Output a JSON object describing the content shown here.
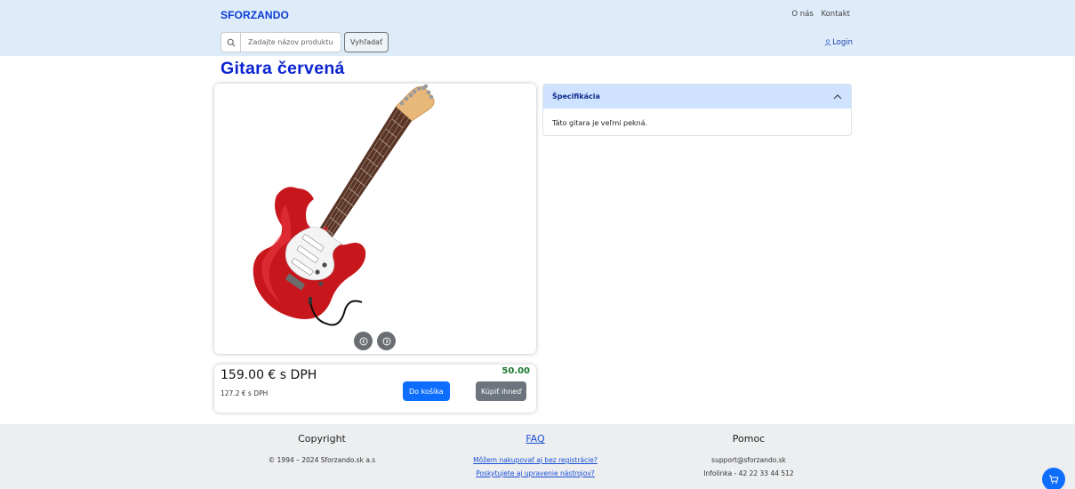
{
  "header": {
    "brand": "SFORZANDO",
    "nav": [
      "O nás",
      "Kontakt"
    ],
    "search_placeholder": "Zadajte názov produktu",
    "search_button": "Vyhľadať",
    "login": "Login"
  },
  "product": {
    "title": "Gitara červená",
    "image_alt": "red electric guitar",
    "price_with_vat": "159.00 € s DPH",
    "price_without_vat": "127.2 € s DPH",
    "discount": "50.00",
    "add_to_cart": "Do košíka",
    "buy_now": "Kúpiť ihneď"
  },
  "spec": {
    "title": "Špecifikácia",
    "body": "Táto gitara je veľmi pekná."
  },
  "footer": {
    "copyright_title": "Copyright",
    "copyright_text": "© 1994 – 2024 Sforzando.sk a.s",
    "faq_title": "FAQ",
    "faq_links": [
      "Môžem nakupovať aj bez registrácie?",
      "Poskytujete aj upravenie nástrojov?"
    ],
    "help_title": "Pomoc",
    "help_email": "support@sforzando.sk",
    "help_phone": "Infolinka - 42 22 33 44 512"
  },
  "colors": {
    "header_bg": "#deecf9",
    "brand": "#0a3bd6",
    "title": "#0a23d1",
    "primary": "#0d6efd",
    "secondary": "#6c757d",
    "discount": "#1b7a2d",
    "spec_header": "#cfe2ff",
    "footer_bg": "#eceef0"
  },
  "icons": [
    "search-icon",
    "user-icon",
    "prev-arrow-icon",
    "next-arrow-icon",
    "chevron-up-icon",
    "cart-icon"
  ]
}
